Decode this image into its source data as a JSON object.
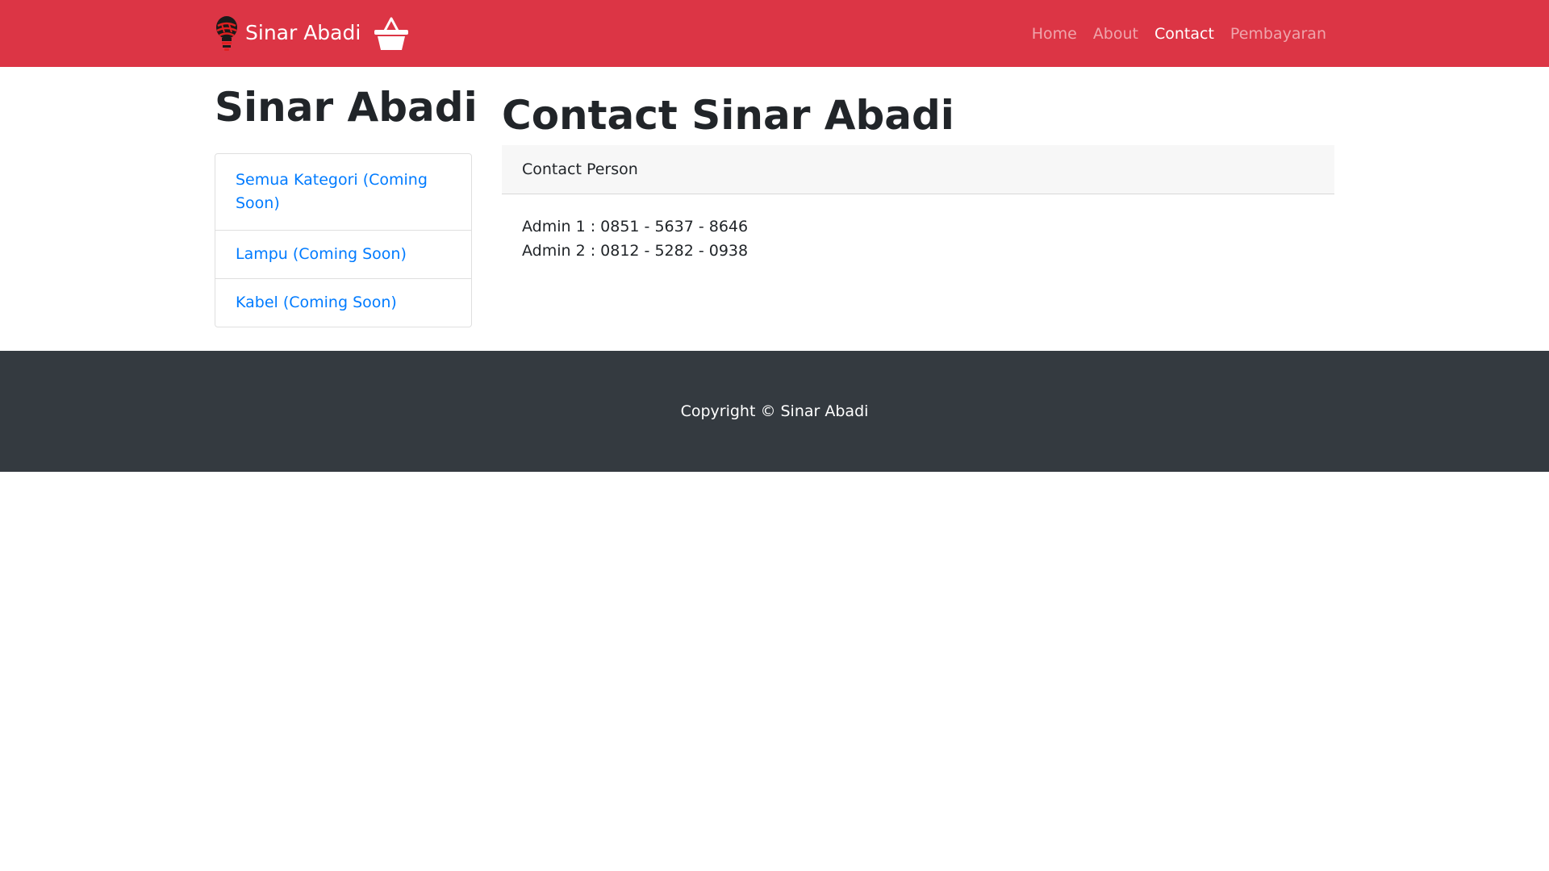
{
  "navbar": {
    "brand_text": "Sinar Abadi",
    "logo_icon": "lightbulb-logo-icon",
    "cart_icon": "basket-icon",
    "background_color": "#dc3545",
    "links": [
      {
        "label": "Home",
        "active": false
      },
      {
        "label": "About",
        "active": false
      },
      {
        "label": "Contact",
        "active": true
      },
      {
        "label": "Pembayaran",
        "active": false
      }
    ]
  },
  "sidebar": {
    "title": "Sinar Abadi",
    "categories": [
      {
        "label": "Semua Kategori (Coming Soon)"
      },
      {
        "label": "Lampu (Coming Soon)"
      },
      {
        "label": "Kabel (Coming Soon)"
      }
    ],
    "link_color": "#007bff"
  },
  "main": {
    "title": "Contact Sinar Abadi",
    "card": {
      "header": "Contact Person",
      "lines": [
        "Admin 1 : 0851 - 5637 - 8646",
        "Admin 2 : 0812 - 5282 - 0938"
      ]
    }
  },
  "footer": {
    "text": "Copyright © Sinar Abadi",
    "background_color": "#343a40"
  }
}
